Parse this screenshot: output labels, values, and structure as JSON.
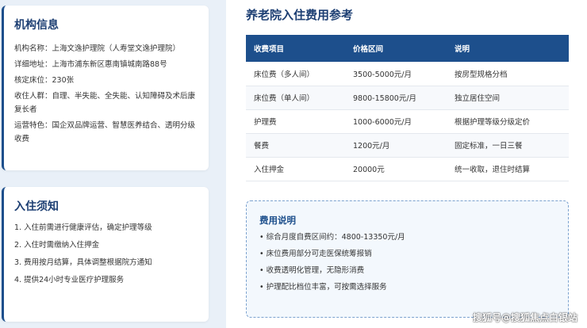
{
  "info": {
    "title": "机构信息",
    "rows": [
      {
        "label": "机构名称：",
        "value": "上海文逸护理院（人寿堂文逸护理院）"
      },
      {
        "label": "详细地址：",
        "value": "上海市浦东新区惠南镇城南路88号"
      },
      {
        "label": "核定床位：",
        "value": "230张"
      },
      {
        "label": "收住人群：",
        "value": "自理、半失能、全失能、认知障碍及术后康复长者"
      },
      {
        "label": "运营特色：",
        "value": "国企双品牌运营、智慧医养结合、透明分级收费"
      }
    ]
  },
  "notice": {
    "title": "入住须知",
    "items": [
      "1. 入住前需进行健康评估，确定护理等级",
      "2. 入住时需缴纳入住押金",
      "3. 费用按月结算，具体调整根据院方通知",
      "4. 提供24小时专业医疗护理服务"
    ]
  },
  "fees": {
    "title": "养老院入住费用参考",
    "headers": [
      "收费项目",
      "价格区间",
      "说明"
    ],
    "rows": [
      [
        "床位费（多人间）",
        "3500-5000元/月",
        "按房型规格分档"
      ],
      [
        "床位费（单人间）",
        "9800-15800元/月",
        "独立居住空间"
      ],
      [
        "护理费",
        "1000-6000元/月",
        "根据护理等级分级定价"
      ],
      [
        "餐费",
        "1200元/月",
        "固定标准，一日三餐"
      ],
      [
        "入住押金",
        "20000元",
        "统一收取，退住时结算"
      ]
    ]
  },
  "desc": {
    "title": "费用说明",
    "items": [
      "综合月度自费区间约：4800-13350元/月",
      "床位费用部分可走医保统筹报销",
      "收费透明化管理，无隐形消费",
      "护理配比档位丰富，可按需选择服务"
    ]
  },
  "watermark": "搜狐号@搜狐焦点白银站"
}
